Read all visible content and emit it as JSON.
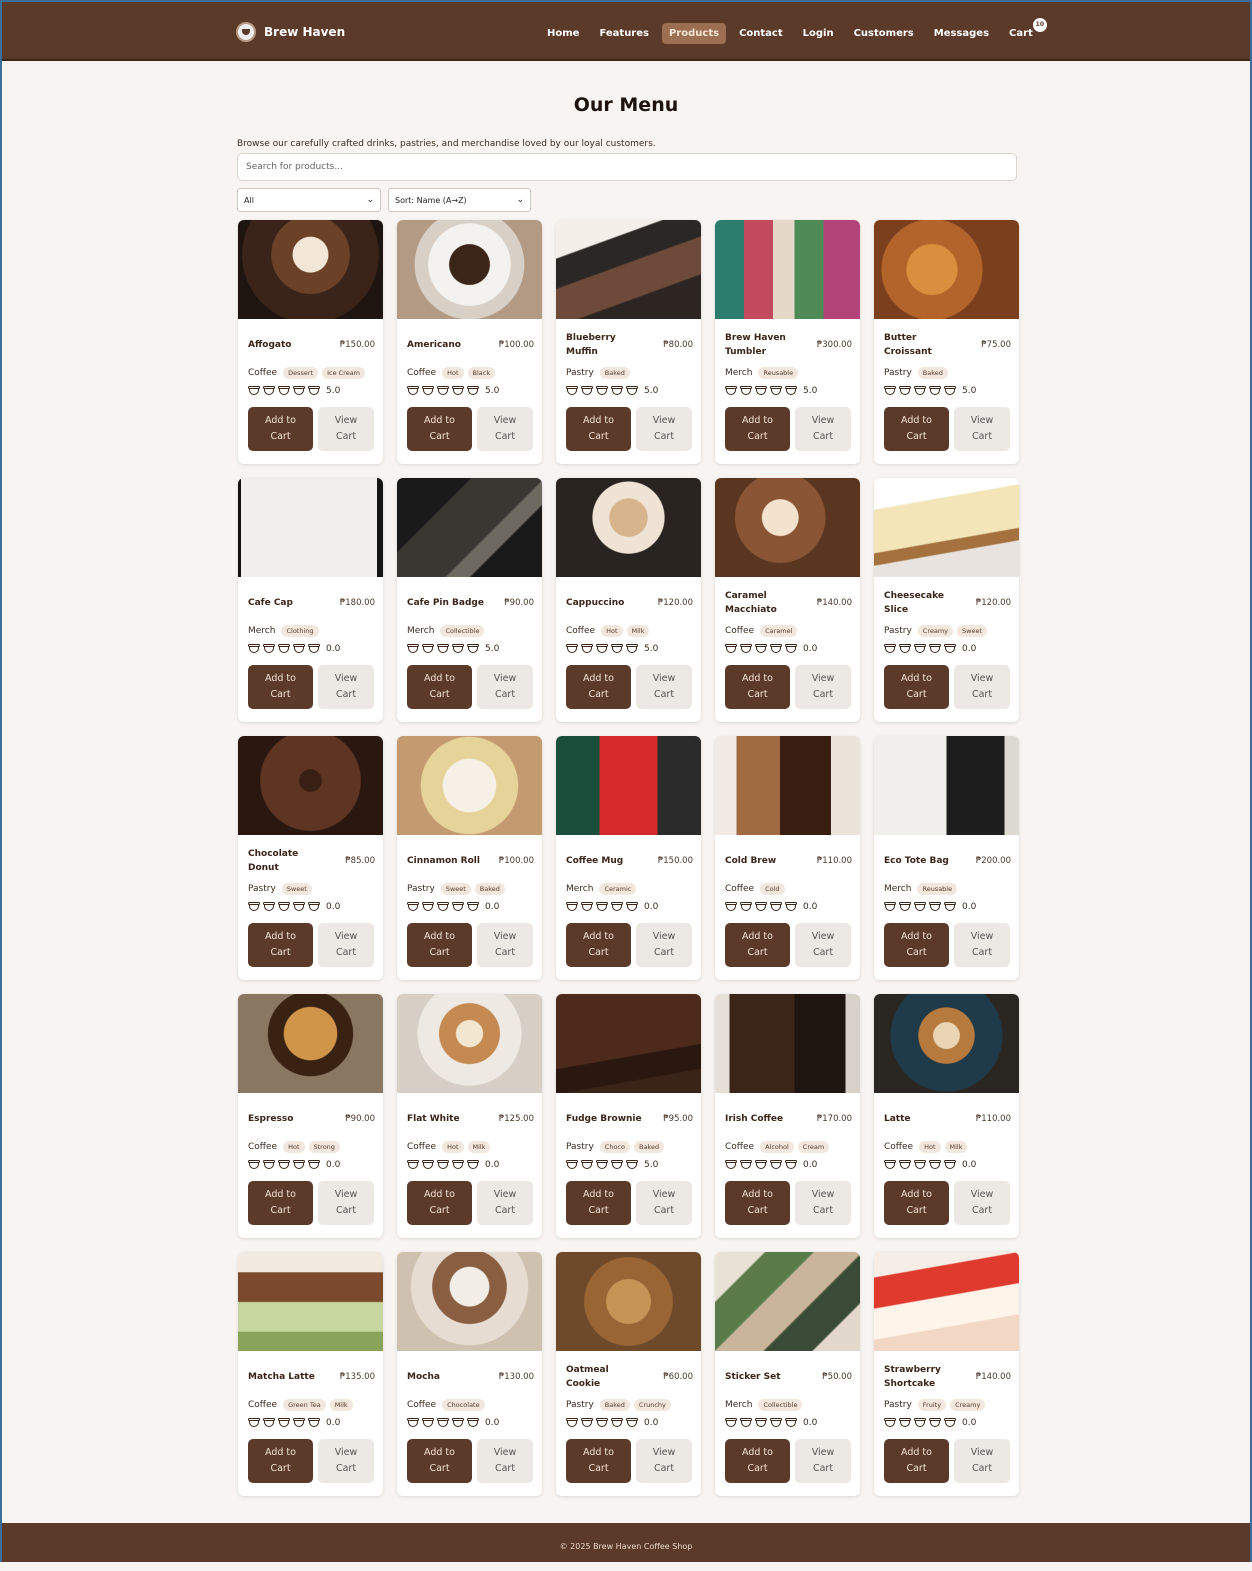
{
  "nav": {
    "brand": "Brew Haven",
    "links": [
      "Home",
      "Features",
      "Products",
      "Contact",
      "Login",
      "Customers",
      "Messages",
      "Cart"
    ],
    "active": "Products",
    "cart_count": "10"
  },
  "page": {
    "title": "Our Menu",
    "intro": "Browse our carefully crafted drinks, pastries, and merchandise loved by our loyal customers.",
    "search_placeholder": "Search for products...",
    "filter_value": "All",
    "sort_value": "Sort: Name (A→Z)"
  },
  "buttons": {
    "add": "Add to Cart",
    "view": "View Cart"
  },
  "products": [
    {
      "name": "Affogato",
      "price": "₱150.00",
      "category": "Coffee",
      "tags": [
        "Dessert",
        "Ice Cream"
      ],
      "rating": "5.0",
      "image": "affogato"
    },
    {
      "name": "Americano",
      "price": "₱100.00",
      "category": "Coffee",
      "tags": [
        "Hot",
        "Black"
      ],
      "rating": "5.0",
      "image": "americano"
    },
    {
      "name": "Blueberry Muffin",
      "price": "₱80.00",
      "category": "Pastry",
      "tags": [
        "Baked"
      ],
      "rating": "5.0",
      "image": "blueberry-muffin"
    },
    {
      "name": "Brew Haven Tumbler",
      "price": "₱300.00",
      "category": "Merch",
      "tags": [
        "Reusable"
      ],
      "rating": "5.0",
      "image": "tumblers"
    },
    {
      "name": "Butter Croissant",
      "price": "₱75.00",
      "category": "Pastry",
      "tags": [
        "Baked"
      ],
      "rating": "5.0",
      "image": "croissants"
    },
    {
      "name": "Cafe Cap",
      "price": "₱180.00",
      "category": "Merch",
      "tags": [
        "Clothing"
      ],
      "rating": "0.0",
      "image": "cap"
    },
    {
      "name": "Cafe Pin Badge",
      "price": "₱90.00",
      "category": "Merch",
      "tags": [
        "Collectible"
      ],
      "rating": "5.0",
      "image": "pin-badges"
    },
    {
      "name": "Cappuccino",
      "price": "₱120.00",
      "category": "Coffee",
      "tags": [
        "Hot",
        "Milk"
      ],
      "rating": "5.0",
      "image": "cappuccino"
    },
    {
      "name": "Caramel Macchiato",
      "price": "₱140.00",
      "category": "Coffee",
      "tags": [
        "Caramel"
      ],
      "rating": "0.0",
      "image": "caramel-macchiato"
    },
    {
      "name": "Cheesecake Slice",
      "price": "₱120.00",
      "category": "Pastry",
      "tags": [
        "Creamy",
        "Sweet"
      ],
      "rating": "0.0",
      "image": "cheesecake"
    },
    {
      "name": "Chocolate Donut",
      "price": "₱85.00",
      "category": "Pastry",
      "tags": [
        "Sweet"
      ],
      "rating": "0.0",
      "image": "donut"
    },
    {
      "name": "Cinnamon Roll",
      "price": "₱100.00",
      "category": "Pastry",
      "tags": [
        "Sweet",
        "Baked"
      ],
      "rating": "0.0",
      "image": "cinnamon-roll"
    },
    {
      "name": "Coffee Mug",
      "price": "₱150.00",
      "category": "Merch",
      "tags": [
        "Ceramic"
      ],
      "rating": "0.0",
      "image": "mugs"
    },
    {
      "name": "Cold Brew",
      "price": "₱110.00",
      "category": "Coffee",
      "tags": [
        "Cold"
      ],
      "rating": "0.0",
      "image": "cold-brew"
    },
    {
      "name": "Eco Tote Bag",
      "price": "₱200.00",
      "category": "Merch",
      "tags": [
        "Reusable"
      ],
      "rating": "0.0",
      "image": "tote-bags"
    },
    {
      "name": "Espresso",
      "price": "₱90.00",
      "category": "Coffee",
      "tags": [
        "Hot",
        "Strong"
      ],
      "rating": "0.0",
      "image": "espresso"
    },
    {
      "name": "Flat White",
      "price": "₱125.00",
      "category": "Coffee",
      "tags": [
        "Hot",
        "Milk"
      ],
      "rating": "0.0",
      "image": "flat-white"
    },
    {
      "name": "Fudge Brownie",
      "price": "₱95.00",
      "category": "Pastry",
      "tags": [
        "Choco",
        "Baked"
      ],
      "rating": "5.0",
      "image": "brownie"
    },
    {
      "name": "Irish Coffee",
      "price": "₱170.00",
      "category": "Coffee",
      "tags": [
        "Alcohol",
        "Cream"
      ],
      "rating": "0.0",
      "image": "irish-coffee"
    },
    {
      "name": "Latte",
      "price": "₱110.00",
      "category": "Coffee",
      "tags": [
        "Hot",
        "Milk"
      ],
      "rating": "0.0",
      "image": "latte"
    },
    {
      "name": "Matcha Latte",
      "price": "₱135.00",
      "category": "Coffee",
      "tags": [
        "Green Tea",
        "Milk"
      ],
      "rating": "0.0",
      "image": "matcha-latte"
    },
    {
      "name": "Mocha",
      "price": "₱130.00",
      "category": "Coffee",
      "tags": [
        "Chocolate"
      ],
      "rating": "0.0",
      "image": "mocha"
    },
    {
      "name": "Oatmeal Cookie",
      "price": "₱60.00",
      "category": "Pastry",
      "tags": [
        "Baked",
        "Crunchy"
      ],
      "rating": "0.0",
      "image": "cookies"
    },
    {
      "name": "Sticker Set",
      "price": "₱50.00",
      "category": "Merch",
      "tags": [
        "Collectible"
      ],
      "rating": "0.0",
      "image": "stickers"
    },
    {
      "name": "Strawberry Shortcake",
      "price": "₱140.00",
      "category": "Pastry",
      "tags": [
        "Fruity",
        "Creamy"
      ],
      "rating": "0.0",
      "image": "strawberry-shortcake"
    }
  ],
  "footer": "© 2025 Brew Haven Coffee Shop"
}
